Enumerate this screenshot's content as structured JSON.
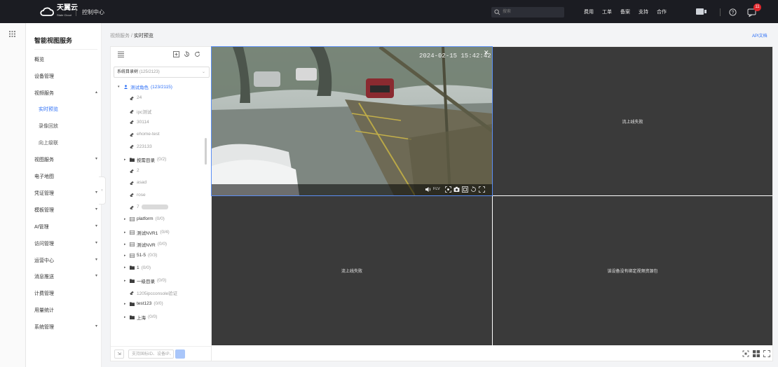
{
  "header": {
    "brand_cn": "天翼云",
    "brand_en": "State Cloud",
    "console_label": "控制中心",
    "search_placeholder": "搜索",
    "nav": [
      "费用",
      "工单",
      "备案",
      "支持",
      "合作"
    ],
    "notification_count": "11"
  },
  "sidebar": {
    "title": "智能视图服务",
    "items": [
      {
        "label": "概览"
      },
      {
        "label": "设备管理"
      },
      {
        "label": "视频服务",
        "chevron": "▴"
      },
      {
        "label": "实时预览",
        "sub": true,
        "active": true
      },
      {
        "label": "录像回放",
        "sub": true
      },
      {
        "label": "向上级联",
        "sub": true
      },
      {
        "label": "视图服务",
        "chevron": "▾"
      },
      {
        "label": "电子地图"
      },
      {
        "label": "凭证管理",
        "chevron": "▾"
      },
      {
        "label": "模板管理",
        "chevron": "▾"
      },
      {
        "label": "AI管理",
        "chevron": "▾"
      },
      {
        "label": "访问管理",
        "chevron": "▾"
      },
      {
        "label": "运营中心",
        "chevron": "▾"
      },
      {
        "label": "消息推送",
        "chevron": "▾"
      },
      {
        "label": "计费管理"
      },
      {
        "label": "用量统计"
      },
      {
        "label": "系统管理",
        "chevron": "▾"
      }
    ]
  },
  "breadcrumb": {
    "parent": "视频服务",
    "sep": " / ",
    "current": "实时预览"
  },
  "api_doc_label": "API文档",
  "tree": {
    "select_label": "系统目录树",
    "select_count": "(125/2123)",
    "rows": [
      {
        "label": "测试角色",
        "count": "(123/2115)",
        "kind": "group",
        "expanded": true,
        "level": 0,
        "blue": true
      },
      {
        "label": "24",
        "kind": "camera",
        "level": 1,
        "dim": true
      },
      {
        "label": "ipc测试",
        "kind": "camera",
        "level": 1,
        "dim": true
      },
      {
        "label": "30114",
        "kind": "camera",
        "level": 1,
        "dim": true
      },
      {
        "label": "ehome-test",
        "kind": "camera",
        "level": 1,
        "dim": true
      },
      {
        "label": "223133",
        "kind": "camera",
        "level": 1,
        "dim": true
      },
      {
        "label": "按需目录",
        "count": "(0/2)",
        "kind": "folder",
        "level": 1
      },
      {
        "label": "2",
        "kind": "camera",
        "level": 1,
        "dim": true
      },
      {
        "label": "asad",
        "kind": "camera",
        "level": 1,
        "dim": true
      },
      {
        "label": "rose",
        "kind": "camera",
        "level": 1,
        "dim": true
      },
      {
        "label": "7",
        "kind": "camera",
        "level": 1,
        "dim": true,
        "blurred": true
      },
      {
        "label": "platform",
        "count": "(0/0)",
        "kind": "nvr",
        "level": 1
      },
      {
        "label": "测试NVR1",
        "count": "(0/4)",
        "kind": "nvr",
        "level": 1
      },
      {
        "label": "测试NVR",
        "count": "(0/0)",
        "kind": "nvr",
        "level": 1
      },
      {
        "label": "51-5",
        "count": "(0/3)",
        "kind": "nvr",
        "level": 1
      },
      {
        "label": "1",
        "count": "(0/0)",
        "kind": "folder",
        "level": 1
      },
      {
        "label": "一级目录",
        "count": "(0/0)",
        "kind": "folder",
        "level": 1
      },
      {
        "label": "1205ipcconsole验证",
        "kind": "camera",
        "level": 1,
        "dim": true
      },
      {
        "label": "test123",
        "count": "(0/0)",
        "kind": "folder",
        "level": 1
      },
      {
        "label": "上海",
        "count": "(0/0)",
        "kind": "folder",
        "level": 1
      }
    ],
    "search_placeholder": "支持国标ID、设备IP、"
  },
  "video": {
    "timestamp": "2024-02-15 15:42:42",
    "format": "FLV",
    "cells": [
      {
        "status": ""
      },
      {
        "status": "流上线失败"
      },
      {
        "status": "流上线失败"
      },
      {
        "status": "该设备没有绑定视频资源包"
      }
    ]
  }
}
